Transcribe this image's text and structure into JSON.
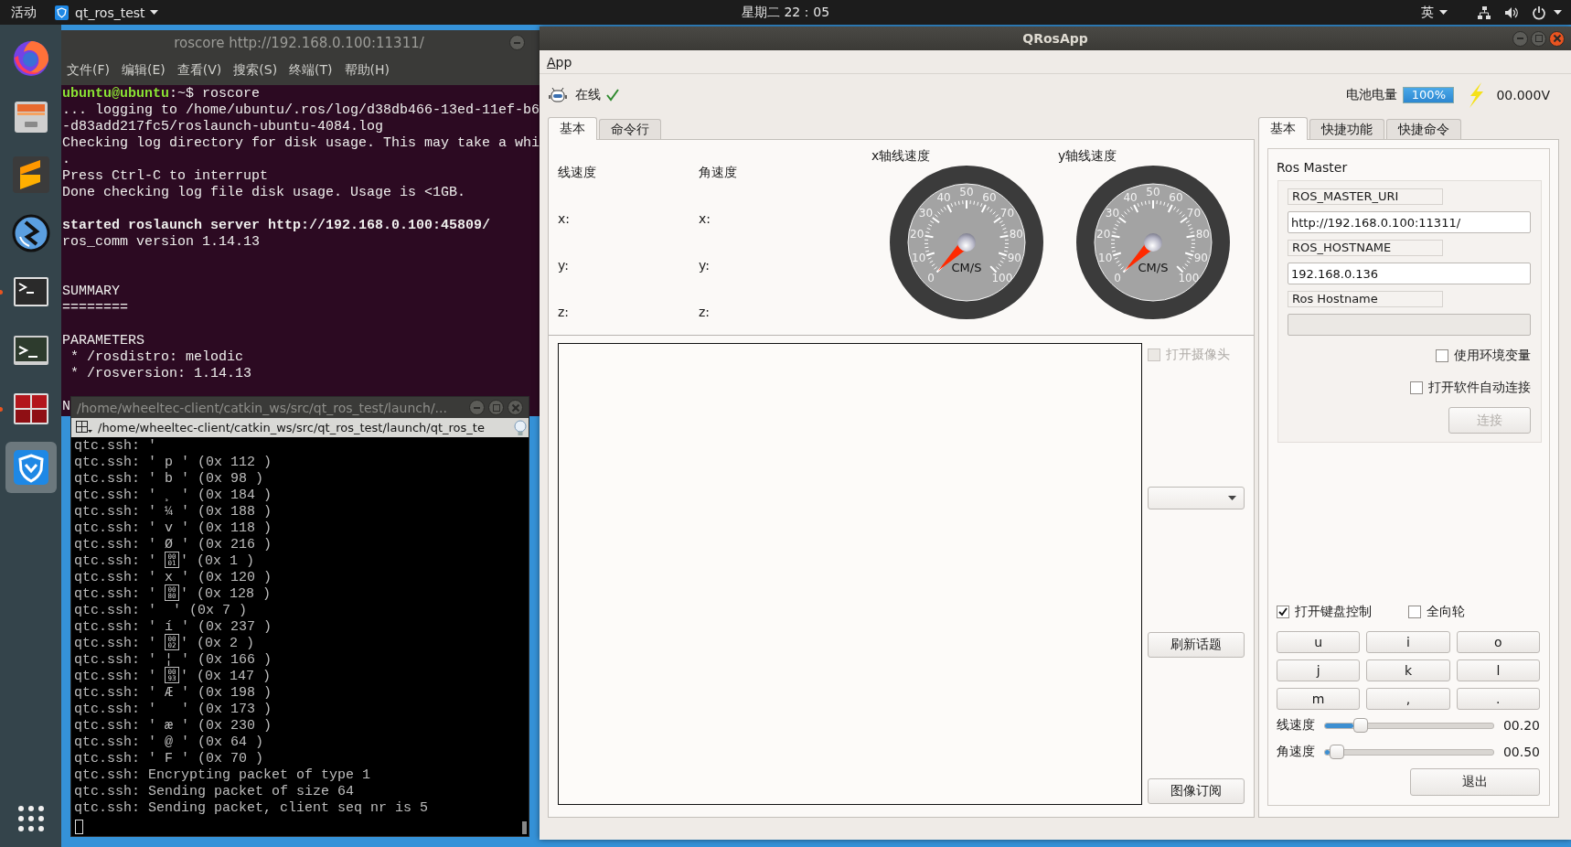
{
  "top_bar": {
    "activities": "活动",
    "app_name": "qt_ros_test",
    "clock": "星期二 22：05",
    "input_method": "英"
  },
  "dock": {
    "items": [
      {
        "kind": "browser",
        "running": false,
        "selected": false
      },
      {
        "kind": "files",
        "running": false,
        "selected": false
      },
      {
        "kind": "editor",
        "running": false,
        "selected": false
      },
      {
        "kind": "remote",
        "running": false,
        "selected": false
      },
      {
        "kind": "terminal",
        "running": true,
        "selected": false
      },
      {
        "kind": "terminal-alt",
        "running": false,
        "selected": false
      },
      {
        "kind": "terminator",
        "running": true,
        "selected": false
      },
      {
        "kind": "shield",
        "running": false,
        "selected": true
      }
    ]
  },
  "terminal_main": {
    "title": "roscore http://192.168.0.100:11311/",
    "menu": [
      "文件(F)",
      "编辑(E)",
      "查看(V)",
      "搜索(S)",
      "终端(T)",
      "帮助(H)"
    ],
    "lines": [
      {
        "kind": "prompt",
        "user": "ubuntu@ubuntu",
        "text": ":~$ roscore"
      },
      {
        "kind": "plain",
        "text": "... logging to /home/ubuntu/.ros/log/d38db466-13ed-11ef-b6"
      },
      {
        "kind": "plain",
        "text": "-d83add217fc5/roslaunch-ubuntu-4084.log"
      },
      {
        "kind": "plain",
        "text": "Checking log directory for disk usage. This may take a whi"
      },
      {
        "kind": "plain",
        "text": "."
      },
      {
        "kind": "plain",
        "text": "Press Ctrl-C to interrupt"
      },
      {
        "kind": "plain",
        "text": "Done checking log file disk usage. Usage is <1GB."
      },
      {
        "kind": "blank"
      },
      {
        "kind": "bold",
        "text": "started roslaunch server http://192.168.0.100:45809/"
      },
      {
        "kind": "plain",
        "text": "ros_comm version 1.14.13"
      },
      {
        "kind": "blank"
      },
      {
        "kind": "blank"
      },
      {
        "kind": "plain",
        "text": "SUMMARY"
      },
      {
        "kind": "plain",
        "text": "========"
      },
      {
        "kind": "blank"
      },
      {
        "kind": "plain",
        "text": "PARAMETERS"
      },
      {
        "kind": "plain",
        "text": " * /rosdistro: melodic"
      },
      {
        "kind": "plain",
        "text": " * /rosversion: 1.14.13"
      },
      {
        "kind": "blank"
      },
      {
        "kind": "plain",
        "text": "N"
      }
    ]
  },
  "terminal_log": {
    "title": "/home/wheeltec-client/catkin_ws/src/qt_ros_test/launch/...",
    "path": "/home/wheeltec-client/catkin_ws/src/qt_ros_test/launch/qt_ros_te",
    "lines": [
      {
        "kind": "plain",
        "text": "qtc.ssh: '"
      },
      {
        "kind": "plain",
        "text": "qtc.ssh: ' p ' (0x 112 )"
      },
      {
        "kind": "plain",
        "text": "qtc.ssh: ' b ' (0x 98 )"
      },
      {
        "kind": "plain",
        "text": "qtc.ssh: ' ¸ ' (0x 184 )"
      },
      {
        "kind": "plain",
        "text": "qtc.ssh: ' ¼ ' (0x 188 )"
      },
      {
        "kind": "plain",
        "text": "qtc.ssh: ' v ' (0x 118 )"
      },
      {
        "kind": "plain",
        "text": "qtc.ssh: ' Ø ' (0x 216 )"
      },
      {
        "kind": "hexbox",
        "before": "qtc.ssh: ' ",
        "hex": "0001",
        "after": "' (0x 1 )"
      },
      {
        "kind": "plain",
        "text": "qtc.ssh: ' x ' (0x 120 )"
      },
      {
        "kind": "hexbox",
        "before": "qtc.ssh: ' ",
        "hex": "0080",
        "after": "' (0x 128 )"
      },
      {
        "kind": "plain",
        "text": "qtc.ssh: '  ' (0x 7 )"
      },
      {
        "kind": "plain",
        "text": "qtc.ssh: ' í ' (0x 237 )"
      },
      {
        "kind": "hexbox",
        "before": "qtc.ssh: ' ",
        "hex": "0002",
        "after": "' (0x 2 )"
      },
      {
        "kind": "plain",
        "text": "qtc.ssh: ' ¦ ' (0x 166 )"
      },
      {
        "kind": "hexbox",
        "before": "qtc.ssh: ' ",
        "hex": "0093",
        "after": "' (0x 147 )"
      },
      {
        "kind": "plain",
        "text": "qtc.ssh: ' Æ ' (0x 198 )"
      },
      {
        "kind": "plain",
        "text": "qtc.ssh: '   ' (0x 173 )"
      },
      {
        "kind": "plain",
        "text": "qtc.ssh: ' æ ' (0x 230 )"
      },
      {
        "kind": "plain",
        "text": "qtc.ssh: ' @ ' (0x 64 )"
      },
      {
        "kind": "plain",
        "text": "qtc.ssh: ' F ' (0x 70 )"
      },
      {
        "kind": "plain",
        "text": "qtc.ssh: Encrypting packet of type 1"
      },
      {
        "kind": "plain",
        "text": "qtc.ssh: Sending packet of size 64"
      },
      {
        "kind": "plain",
        "text": "qtc.ssh: Sending packet, client seq nr is 5"
      }
    ]
  },
  "app": {
    "title": "QRosApp",
    "menu": [
      "App"
    ],
    "status": {
      "text": "在线",
      "online": true
    },
    "battery": {
      "label": "电池电量",
      "level": 1,
      "reading": "100%",
      "voltage": "00.000V"
    },
    "left_tabs": [
      {
        "label": "基本",
        "selected": true
      },
      {
        "label": "命令行",
        "selected": false
      }
    ],
    "velocity": [
      {
        "title": "线速度",
        "axes": [
          "x:",
          "y:",
          "z:"
        ]
      },
      {
        "title": "角速度",
        "axes": [
          "x:",
          "y:",
          "z:"
        ]
      }
    ],
    "gauges": [
      {
        "title": "x轴线速度",
        "ticks": [
          "0",
          "10",
          "20",
          "30",
          "40",
          "50",
          "60",
          "70",
          "80",
          "90",
          "100"
        ],
        "unit": "CM/S"
      },
      {
        "title": "y轴线速度",
        "ticks": [
          "0",
          "10",
          "20",
          "30",
          "40",
          "50",
          "60",
          "70",
          "80",
          "90",
          "100"
        ],
        "unit": "CM/S"
      }
    ],
    "camera": {
      "label": "打开摄像头",
      "checked": false,
      "disabled": true
    },
    "topic_buttons": [
      "刷新话题",
      "图像订阅"
    ],
    "right_tabs": [
      {
        "label": "基本",
        "selected": true
      },
      {
        "label": "快捷功能",
        "selected": false
      },
      {
        "label": "快捷命令",
        "selected": false
      }
    ],
    "ros_master": {
      "title": "Ros Master",
      "fields": [
        {
          "label": "ROS_MASTER_URI",
          "value": "http://192.168.0.100:11311/",
          "disabled": false
        },
        {
          "label": "ROS_HOSTNAME",
          "value": "192.168.0.136",
          "disabled": false
        },
        {
          "label": "Ros Hostname",
          "disabled": true
        }
      ],
      "options": [
        {
          "label": "使用环境变量",
          "checked": false
        },
        {
          "label": "打开软件自动连接",
          "checked": false
        }
      ],
      "connect": {
        "label": "连接",
        "disabled": true
      }
    },
    "keyboard": {
      "options": [
        {
          "label": "打开键盘控制",
          "checked": true
        },
        {
          "label": "全向轮",
          "checked": false
        }
      ],
      "keys": [
        "u",
        "i",
        "o",
        "j",
        "k",
        "l",
        "m",
        ",",
        "."
      ],
      "sliders": [
        {
          "label": "线速度",
          "level": 0.21,
          "reading": "00.20"
        },
        {
          "label": "角速度",
          "level": 0.07,
          "reading": "00.50"
        }
      ],
      "exit": "退出"
    }
  }
}
